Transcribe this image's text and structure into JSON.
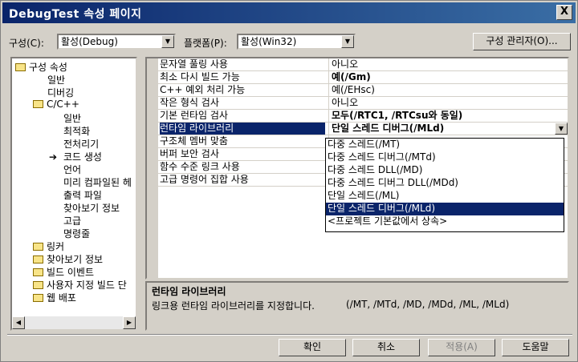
{
  "window": {
    "title": "DebugTest 속성 페이지",
    "close": "X"
  },
  "toolbar": {
    "config_label": "구성(C):",
    "config_value": "활성(Debug)",
    "platform_label": "플랫폼(P):",
    "platform_value": "활성(Win32)",
    "manager_button": "구성 관리자(O)..."
  },
  "tree": {
    "root": "구성 속성",
    "items": [
      "일반",
      "디버깅"
    ],
    "cpp_label": "C/C++",
    "cpp_children": [
      "일반",
      "최적화",
      "전처리기",
      "코드 생성",
      "언어",
      "미리 컴파일된 헤",
      "출력 파일",
      "찾아보기 정보",
      "고급",
      "명령줄"
    ],
    "other_folders": [
      "링커",
      "찾아보기 정보",
      "빌드 이벤트",
      "사용자 지정 빌드 단",
      "웹 배포"
    ]
  },
  "properties": {
    "rows": [
      {
        "name": "문자열 풀링 사용",
        "value": "아니오"
      },
      {
        "name": "최소 다시 빌드 가능",
        "value": "예(/Gm)"
      },
      {
        "name": "C++ 예외 처리 가능",
        "value": "예(/EHsc)"
      },
      {
        "name": "작은 형식 검사",
        "value": "아니오"
      },
      {
        "name": "기본 런타임 검사",
        "value": "모두(/RTC1, /RTCsu와 동일)"
      },
      {
        "name": "런타임 라이브러리",
        "value": "단일 스레드 디버그(/MLd)"
      },
      {
        "name": "구조체 멤버 맞춤",
        "value": ""
      },
      {
        "name": "버퍼 보안 검사",
        "value": ""
      },
      {
        "name": "함수 수준 링크 사용",
        "value": ""
      },
      {
        "name": "고급 명령어 집합 사용",
        "value": ""
      }
    ],
    "selected_index": 5
  },
  "dropdown": {
    "options": [
      "다중 스레드(/MT)",
      "다중 스레드 디버그(/MTd)",
      "다중 스레드 DLL(/MD)",
      "다중 스레드 디버그 DLL(/MDd)",
      "단일 스레드(/ML)",
      "단일 스레드 디버그(/MLd)",
      "<프로젝트 기본값에서 상속>"
    ],
    "selected_index": 5
  },
  "description": {
    "title": "런타임 라이브러리",
    "text": "링크용 런타임 라이브러리를 지정합니다.",
    "codes": "(/MT, /MTd, /MD, /MDd, /ML, /MLd)"
  },
  "buttons": {
    "ok": "확인",
    "cancel": "취소",
    "apply": "적용(A)",
    "help": "도움말"
  }
}
